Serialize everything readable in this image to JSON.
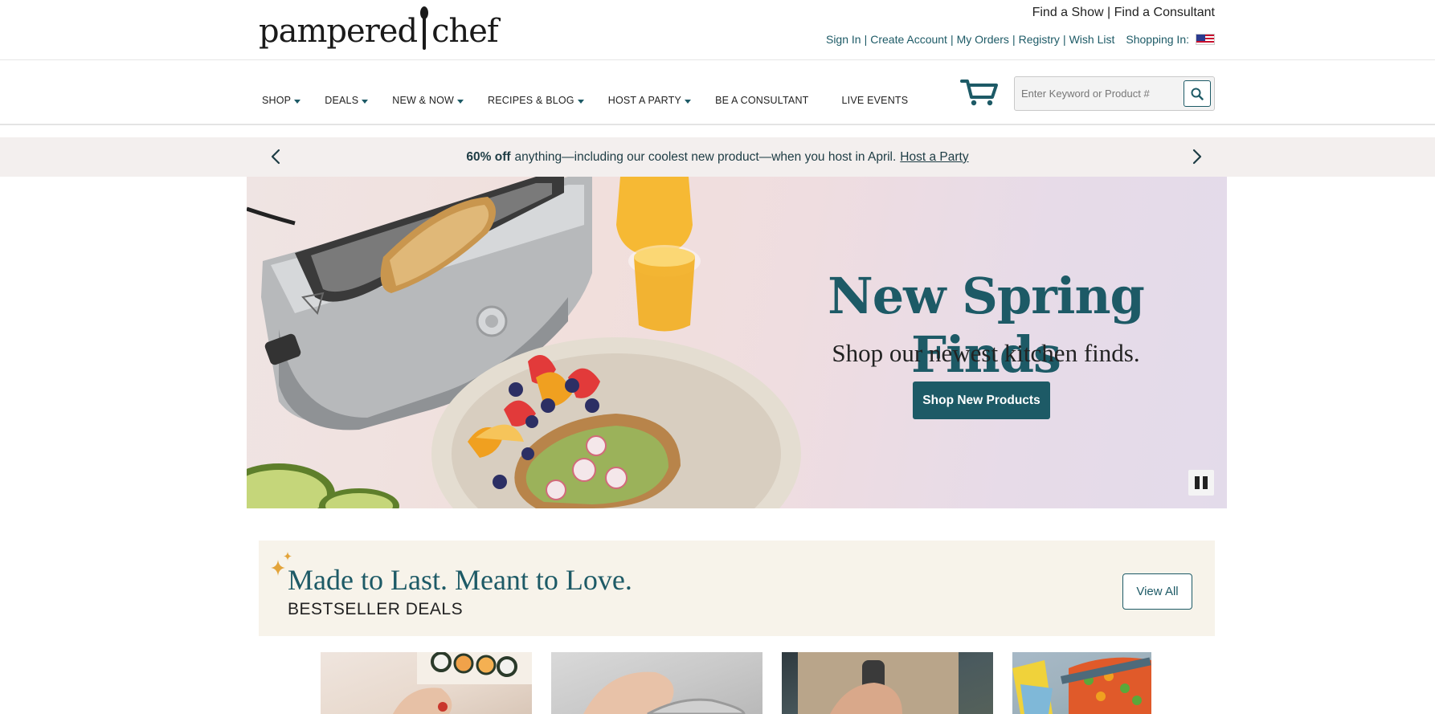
{
  "header": {
    "logo_text": "pampered chef",
    "find_show": "Find a Show",
    "find_sep": "|",
    "find_consultant": "Find a Consultant",
    "sign_in": "Sign In",
    "create_account": "Create Account",
    "my_orders": "My Orders",
    "registry": "Registry",
    "wish_list": "Wish List",
    "sep": "|",
    "shopping_in": "Shopping In:",
    "flag_icon": "us-flag-icon"
  },
  "nav": {
    "items": [
      {
        "label": "SHOP",
        "has_dropdown": true
      },
      {
        "label": "DEALS",
        "has_dropdown": true
      },
      {
        "label": "NEW & NOW",
        "has_dropdown": true
      },
      {
        "label": "RECIPES & BLOG",
        "has_dropdown": true
      },
      {
        "label": "HOST A PARTY",
        "has_dropdown": true
      },
      {
        "label": "BE A CONSULTANT",
        "has_dropdown": false
      },
      {
        "label": "LIVE EVENTS",
        "has_dropdown": false
      }
    ],
    "cart_icon": "cart-icon",
    "search_placeholder": "Enter Keyword or Product #",
    "search_icon": "search-icon"
  },
  "promo": {
    "bold": "60% off",
    "text": "anything—including our coolest new product—when you host in April.",
    "link": "Host a Party"
  },
  "hero": {
    "title": "New Spring Finds",
    "subtitle": "Shop our newest kitchen finds.",
    "cta": "Shop New Products",
    "pause_icon": "pause-icon"
  },
  "bestsellers": {
    "title": "Made to Last. Meant to Love.",
    "subtitle": "BESTSELLER DEALS",
    "view_all": "View All",
    "sparkle_icon": "sparkle-icon"
  },
  "colors": {
    "brand_teal": "#1d5a66",
    "promo_bg": "#f3efee",
    "best_bg": "#f7f3ea"
  }
}
